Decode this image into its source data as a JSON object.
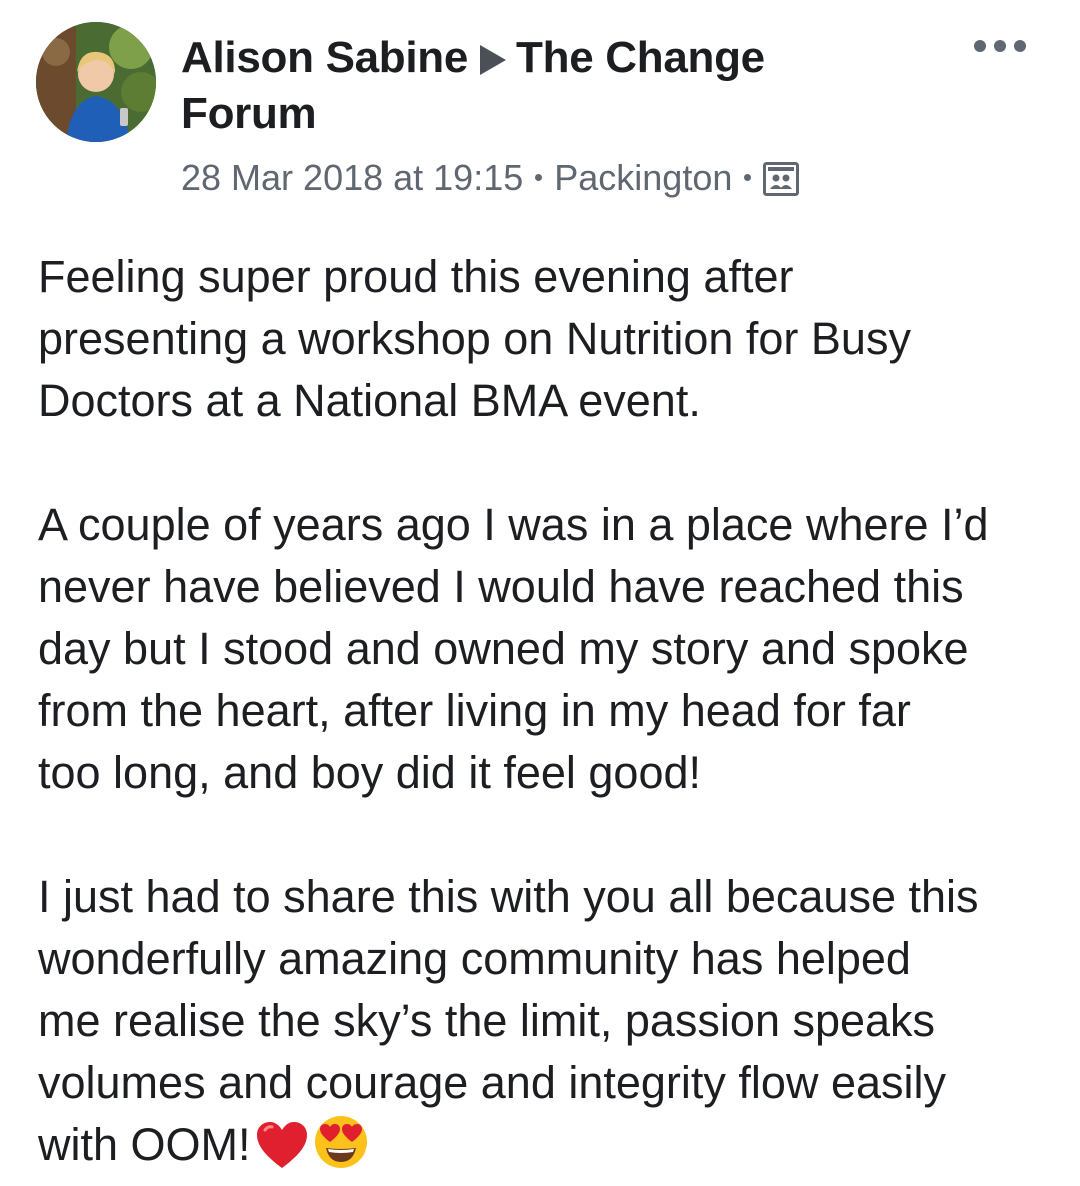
{
  "post": {
    "author": "Alison Sabine",
    "group": "The Change Forum",
    "timestamp": "28 Mar 2018 at 19:15",
    "location": "Packington",
    "audience_icon": "group-audience-icon",
    "more_icon": "more-options-icon",
    "paragraphs": [
      "Feeling super proud this evening after\npresenting a workshop on Nutrition for Busy\nDoctors at a National BMA event.",
      "A couple of years ago I was in a place where I’d\nnever have believed I would have reached this\nday but I stood and owned my story and spoke\nfrom the heart, after living in my head for far\ntoo long, and boy did it feel good!",
      "I just had to share this with you all because this\nwonderfully amazing community has helped\nme realise the sky’s the limit, passion speaks\nvolumes and courage and integrity flow easily\nwith OOM!"
    ],
    "emojis": [
      "red-heart",
      "heart-eyes-face"
    ]
  },
  "colors": {
    "text": "#1c1e21",
    "meta": "#606770",
    "heart": "#e0202f",
    "emoji_face": "#fcc21b"
  }
}
